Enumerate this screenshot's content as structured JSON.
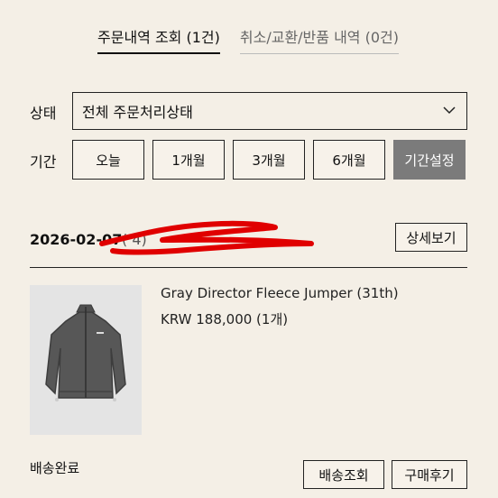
{
  "tabs": {
    "order_history": "주문내역 조회 (1건)",
    "cancel_exchange": "취소/교환/반품 내역 (0건)"
  },
  "filters": {
    "status_label": "상태",
    "status_value": "전체 주문처리상태",
    "period_label": "기간",
    "period_buttons": [
      "오늘",
      "1개월",
      "3개월",
      "6개월",
      "기간설정"
    ]
  },
  "order": {
    "date": "2026-02-07",
    "date_suffix": "(          4)",
    "detail_button": "상세보기",
    "product_name": "Gray Director Fleece Jumper (31th)",
    "product_price": "KRW 188,000 (1개)",
    "status": "배송완료",
    "track_button": "배송조회",
    "review_button": "구매후기"
  },
  "colors": {
    "background": "#f4efe6",
    "custom_button": "#7b7b7b",
    "redaction": "#e00000"
  },
  "icons": {
    "select_arrow": "chevron-down-icon"
  }
}
